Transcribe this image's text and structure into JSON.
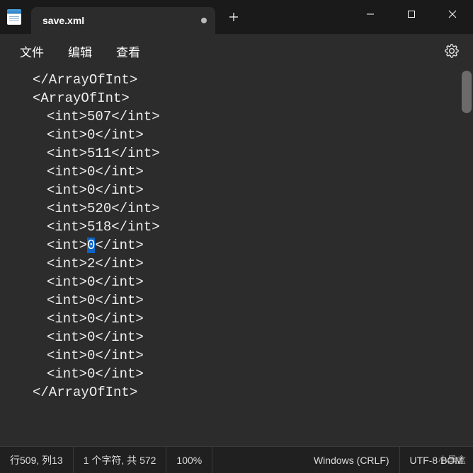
{
  "tab": {
    "title": "save.xml"
  },
  "menu": {
    "file": "文件",
    "edit": "编辑",
    "view": "查看"
  },
  "lines": [
    {
      "indent": 1,
      "open": "</ArrayOfInt>",
      "val": null,
      "close": ""
    },
    {
      "indent": 1,
      "open": "<ArrayOfInt>",
      "val": null,
      "close": ""
    },
    {
      "indent": 2,
      "open": "<int>",
      "val": "507",
      "close": "</int>"
    },
    {
      "indent": 2,
      "open": "<int>",
      "val": "0",
      "close": "</int>"
    },
    {
      "indent": 2,
      "open": "<int>",
      "val": "511",
      "close": "</int>"
    },
    {
      "indent": 2,
      "open": "<int>",
      "val": "0",
      "close": "</int>"
    },
    {
      "indent": 2,
      "open": "<int>",
      "val": "0",
      "close": "</int>"
    },
    {
      "indent": 2,
      "open": "<int>",
      "val": "520",
      "close": "</int>"
    },
    {
      "indent": 2,
      "open": "<int>",
      "val": "518",
      "close": "</int>"
    },
    {
      "indent": 2,
      "open": "<int>",
      "val": "0",
      "close": "</int>",
      "selected": true
    },
    {
      "indent": 2,
      "open": "<int>",
      "val": "2",
      "close": "</int>"
    },
    {
      "indent": 2,
      "open": "<int>",
      "val": "0",
      "close": "</int>"
    },
    {
      "indent": 2,
      "open": "<int>",
      "val": "0",
      "close": "</int>"
    },
    {
      "indent": 2,
      "open": "<int>",
      "val": "0",
      "close": "</int>"
    },
    {
      "indent": 2,
      "open": "<int>",
      "val": "0",
      "close": "</int>"
    },
    {
      "indent": 2,
      "open": "<int>",
      "val": "0",
      "close": "</int>"
    },
    {
      "indent": 2,
      "open": "<int>",
      "val": "0",
      "close": "</int>"
    },
    {
      "indent": 1,
      "open": "</ArrayOfInt>",
      "val": null,
      "close": ""
    }
  ],
  "status": {
    "pos_prefix": "行 ",
    "row": "509",
    "pos_mid": ",  列 ",
    "col": "13",
    "chars": "1 个字符,  共 572",
    "zoom": "100%",
    "eol": "Windows (CRLF)",
    "encoding": "UTF-8 BOM"
  },
  "watermark": "小黑盒"
}
